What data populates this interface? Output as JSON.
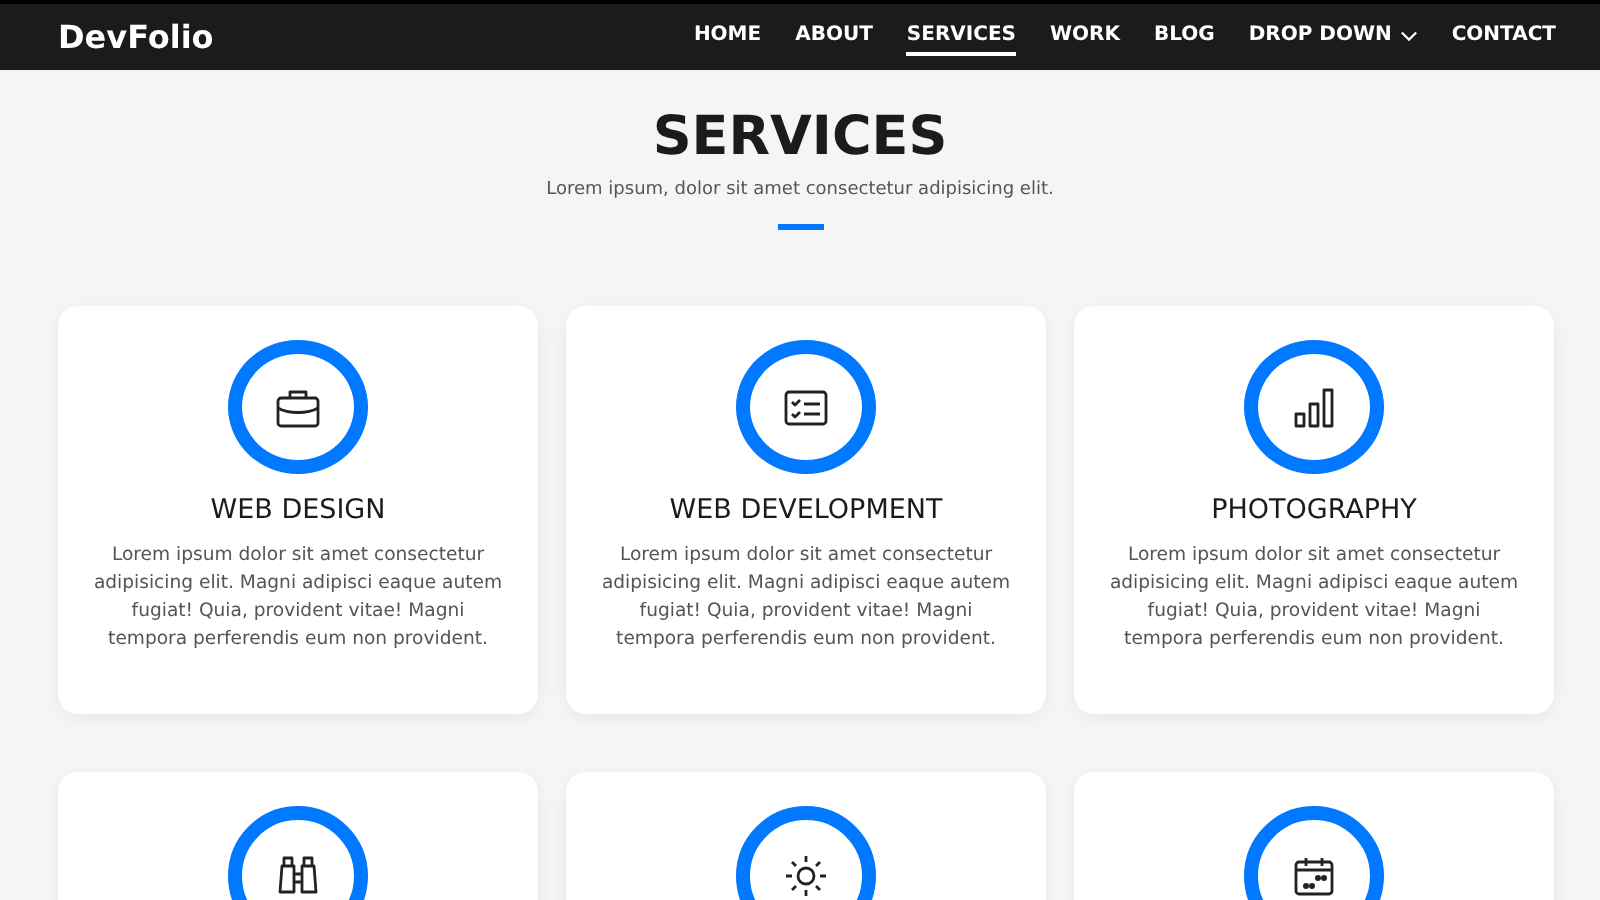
{
  "brand": "DevFolio",
  "nav": [
    {
      "label": "HOME",
      "selected": false,
      "kind": "link"
    },
    {
      "label": "ABOUT",
      "selected": false,
      "kind": "link"
    },
    {
      "label": "SERVICES",
      "selected": true,
      "kind": "link"
    },
    {
      "label": "WORK",
      "selected": false,
      "kind": "link"
    },
    {
      "label": "BLOG",
      "selected": false,
      "kind": "link"
    },
    {
      "label": "DROP DOWN",
      "selected": false,
      "kind": "dropdown"
    },
    {
      "label": "CONTACT",
      "selected": false,
      "kind": "link"
    }
  ],
  "section": {
    "title": "SERVICES",
    "subtitle": "Lorem ipsum, dolor sit amet consectetur adipisicing elit."
  },
  "services": [
    {
      "kind": "full",
      "title": "WEB DESIGN",
      "text": "Lorem ipsum dolor sit amet consectetur adipisicing elit. Magni adipisci eaque autem fugiat! Quia, provident vitae! Magni tempora perferendis eum non provident."
    },
    {
      "kind": "full",
      "title": "WEB DEVELOPMENT",
      "text": "Lorem ipsum dolor sit amet consectetur adipisicing elit. Magni adipisci eaque autem fugiat! Quia, provident vitae! Magni tempora perferendis eum non provident."
    },
    {
      "kind": "full",
      "title": "PHOTOGRAPHY",
      "text": "Lorem ipsum dolor sit amet consectetur adipisicing elit. Magni adipisci eaque autem fugiat! Quia, provident vitae! Magni tempora perferendis eum non provident."
    },
    {
      "kind": "partial"
    },
    {
      "kind": "partial"
    },
    {
      "kind": "partial"
    }
  ]
}
